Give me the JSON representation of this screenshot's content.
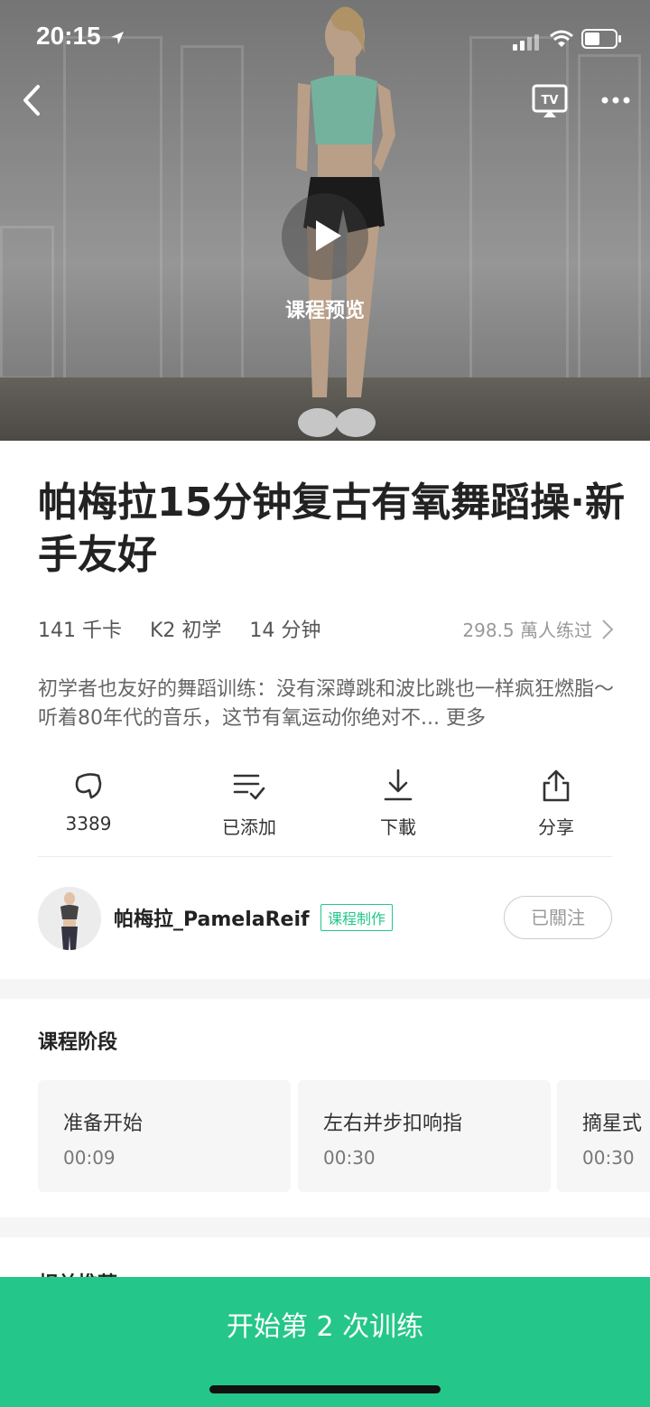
{
  "status": {
    "time": "20:15"
  },
  "hero": {
    "preview_label": "课程预览"
  },
  "course": {
    "title": "帕梅拉15分钟复古有氧舞蹈操·新手友好",
    "calories": "141 千卡",
    "level": "K2 初学",
    "duration": "14 分钟",
    "trained": "298.5 萬人练过",
    "description": "初学者也友好的舞蹈训练：没有深蹲跳和波比跳也一样疯狂燃脂～听着80年代的音乐，这节有氧运动你绝对不...",
    "more": "更多"
  },
  "actions": {
    "like_count": "3389",
    "added": "已添加",
    "download": "下載",
    "share": "分享"
  },
  "author": {
    "name": "帕梅拉_PamelaReif",
    "badge": "课程制作",
    "follow": "已關注"
  },
  "stages": {
    "title": "课程阶段",
    "items": [
      {
        "name": "准备开始",
        "duration": "00:09"
      },
      {
        "name": "左右并步扣响指",
        "duration": "00:30"
      },
      {
        "name": "摘星式",
        "duration": "00:30"
      }
    ]
  },
  "recommend": {
    "title": "相关推荐"
  },
  "start_button": "开始第 2 次训练",
  "colors": {
    "accent": "#24c789"
  }
}
